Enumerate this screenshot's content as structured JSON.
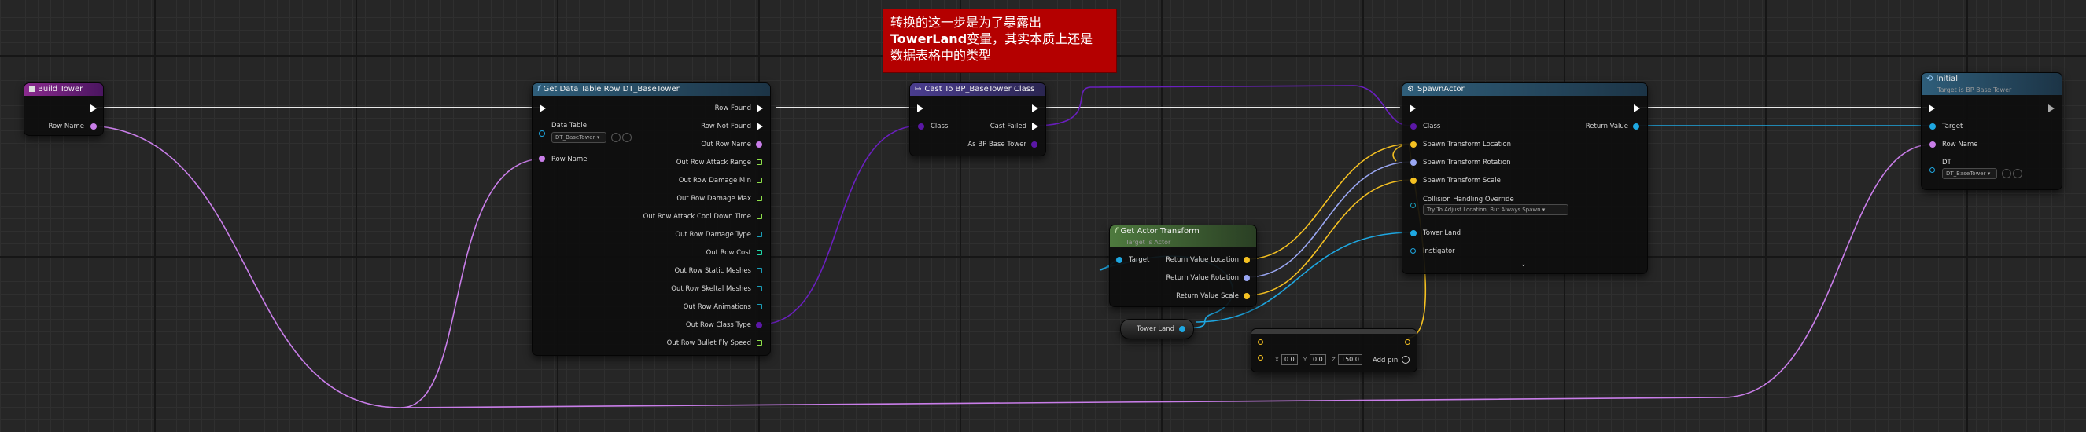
{
  "comment": {
    "line1": "转换的这一步是为了暴露出",
    "line2_bold": "TowerLand",
    "line2_rest": "变量，其实本质上还是",
    "line3": "数据表格中的类型"
  },
  "build_tower": {
    "title": "Build Tower",
    "row_name": "Row Name"
  },
  "get_row": {
    "title": "Get Data Table Row DT_BaseTower",
    "data_table": "Data Table",
    "data_table_value": "DT_BaseTower",
    "row_name": "Row Name",
    "outputs": [
      "Row Found",
      "Row Not Found",
      "Out Row Name",
      "Out Row Attack Range",
      "Out Row Damage Min",
      "Out Row Damage Max",
      "Out Row Attack Cool Down Time",
      "Out Row Damage Type",
      "Out Row Cost",
      "Out Row Static Meshes",
      "Out Row Skeltal Meshes",
      "Out Row Animations",
      "Out Row Class Type",
      "Out Row Bullet Fly Speed"
    ]
  },
  "cast": {
    "title": "Cast To BP_BaseTower Class",
    "class": "Class",
    "cast_failed": "Cast Failed",
    "as": "As BP Base Tower"
  },
  "spawn": {
    "title": "SpawnActor",
    "class": "Class",
    "return_value": "Return Value",
    "location": "Spawn Transform Location",
    "rotation": "Spawn Transform Rotation",
    "scale": "Spawn Transform Scale",
    "collision": "Collision Handling Override",
    "collision_value": "Try To Adjust Location, But Always Spawn",
    "tower_land": "Tower Land",
    "instigator": "Instigator"
  },
  "get_transform": {
    "title": "Get Actor Transform",
    "subtitle": "Target is Actor",
    "target": "Target",
    "loc": "Return Value Location",
    "rot": "Return Value Rotation",
    "scale": "Return Value Scale"
  },
  "tower_land_var": "Tower Land",
  "make_vector": {
    "x": "0.0",
    "y": "0.0",
    "z": "150.0",
    "add_pin": "Add pin",
    "x_lbl": "X",
    "y_lbl": "Y",
    "z_lbl": "Z"
  },
  "initial": {
    "title": "Initial",
    "subtitle": "Target is BP Base Tower",
    "target": "Target",
    "row_name": "Row Name",
    "dt": "DT",
    "dt_value": "DT_BaseTower"
  },
  "colors": {
    "exec": "#ffffff",
    "name": "#c87de8",
    "object": "#1ea7e1",
    "class": "#5b17a6",
    "vector": "#f5c122",
    "rotator": "#9aa7f3",
    "struct": "#1a9db8"
  }
}
